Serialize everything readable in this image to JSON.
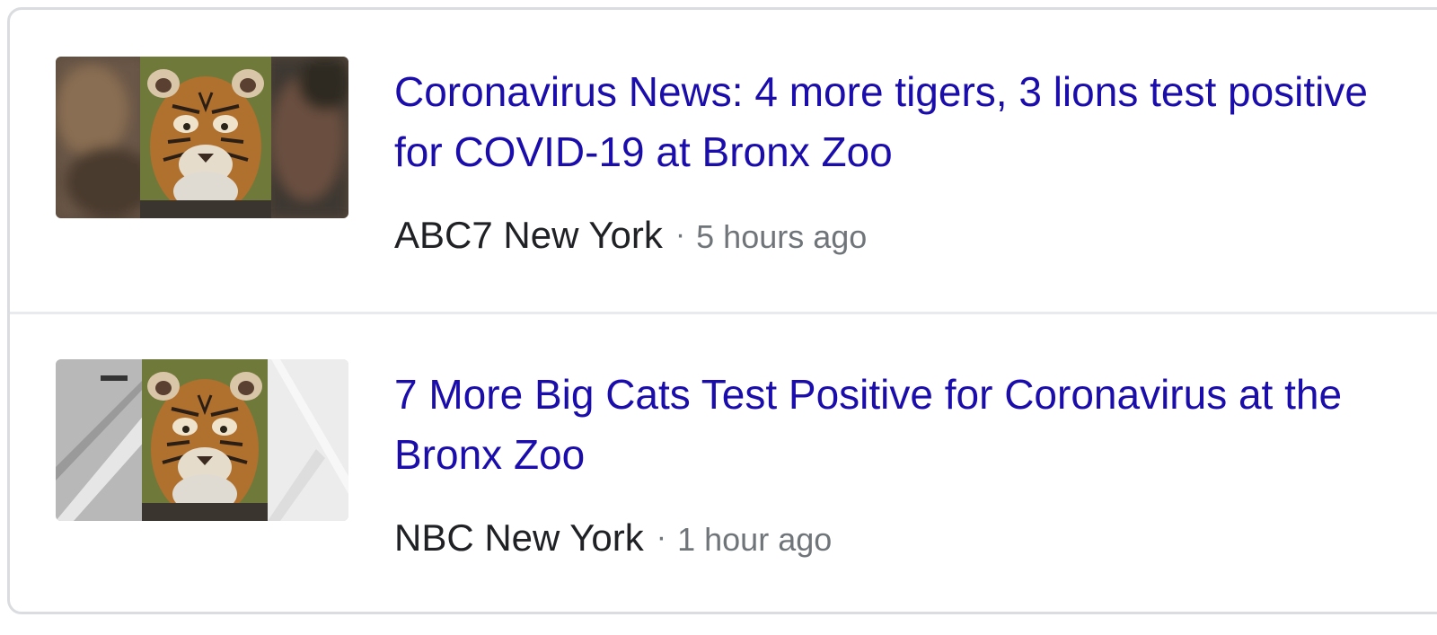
{
  "news": {
    "items": [
      {
        "headline": "Coronavirus News: 4 more tigers, 3 lions test positive for COVID-19 at Bronx Zoo",
        "source": "ABC7 New York",
        "separator": "·",
        "time": "5 hours ago",
        "thumbnail_icon": "tiger-photo"
      },
      {
        "headline": "7 More Big Cats Test Positive for Coronavirus at the Bronx Zoo",
        "source": "NBC New York",
        "separator": "·",
        "time": "1 hour ago",
        "thumbnail_icon": "tiger-photo"
      }
    ]
  },
  "colors": {
    "link": "#1a0dab",
    "source": "#202124",
    "meta": "#70757a",
    "border": "#dadce0"
  }
}
